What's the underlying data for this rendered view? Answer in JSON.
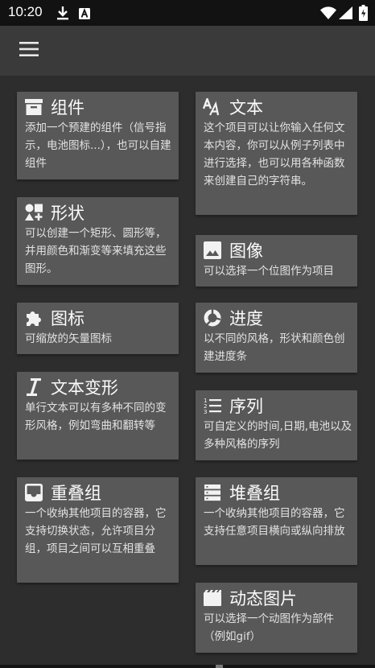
{
  "status_bar": {
    "time": "10:20",
    "icons": [
      "download-icon",
      "a-notification-icon",
      "wifi-icon",
      "signal-icon",
      "battery-icon"
    ]
  },
  "app_bar": {
    "menu_icon": "hamburger-menu-icon"
  },
  "colors": {
    "background": "#2d2d2d",
    "app_bar": "#3a3a3a",
    "card": "#585858",
    "status_bar": "#121212",
    "text": "#f2f2f2"
  },
  "cards": {
    "component": {
      "icon": "component-icon",
      "title": "组件",
      "desc": "添加一个预建的组件（信号指示，电池图标...），也可以自建组件"
    },
    "text": {
      "icon": "text-icon",
      "title": "文本",
      "desc": "这个项目可以让你输入任何文本内容，你可以从例子列表中进行选择，也可以用各种函数来创建自己的字符串。"
    },
    "shape": {
      "icon": "shape-icon",
      "title": "形状",
      "desc": "可以创建一个矩形、圆形等，并用颜色和渐变等来填充这些图形。"
    },
    "image": {
      "icon": "image-icon",
      "title": "图像",
      "desc": "可以选择一个位图作为项目"
    },
    "icon_item": {
      "icon": "puzzle-icon",
      "title": "图标",
      "desc": "可缩放的矢量图标"
    },
    "progress": {
      "icon": "progress-icon",
      "title": "进度",
      "desc": "以不同的风格，形状和颜色创建进度条"
    },
    "text_transform": {
      "icon": "italic-text-icon",
      "title": "文本变形",
      "desc": "单行文本可以有多种不同的变形风格，例如弯曲和翻转等"
    },
    "series": {
      "icon": "list-numbered-icon",
      "title": "序列",
      "desc": "可自定义的时间,日期,电池以及多种风格的序列"
    },
    "overlap_group": {
      "icon": "overlap-group-icon",
      "title": "重叠组",
      "desc": "一个收纳其他项目的容器，它支持切换状态，允许项目分组，项目之间可以互相重叠"
    },
    "stack_group": {
      "icon": "stack-group-icon",
      "title": "堆叠组",
      "desc": "一个收纳其他项目的容器，它支持任意项目横向或纵向排放"
    },
    "animated_image": {
      "icon": "movie-icon",
      "title": "动态图片",
      "desc": "可以选择一个动图作为部件（例如gif）"
    }
  }
}
